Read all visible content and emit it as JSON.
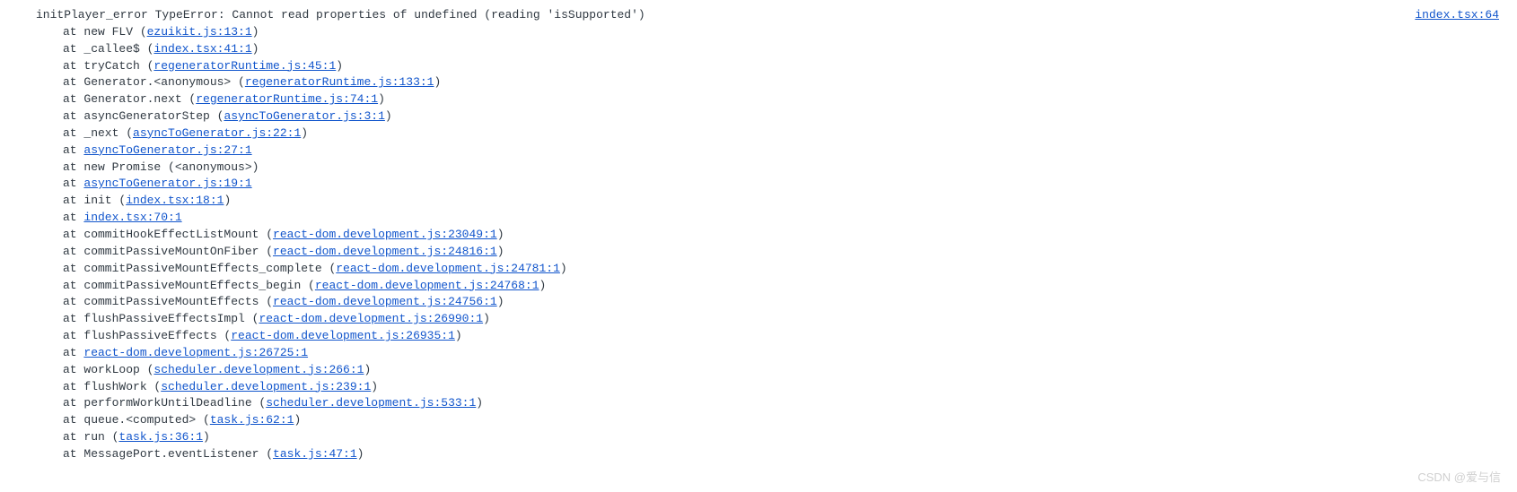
{
  "source_link": "index.tsx:64",
  "error": {
    "prefix": "initPlayer_error TypeError: Cannot read properties of undefined (reading 'isSupported')",
    "stack": [
      {
        "pre": "at new FLV (",
        "link": "ezuikit.js:13:1",
        "post": ")"
      },
      {
        "pre": "at _callee$ (",
        "link": "index.tsx:41:1",
        "post": ")"
      },
      {
        "pre": "at tryCatch (",
        "link": "regeneratorRuntime.js:45:1",
        "post": ")"
      },
      {
        "pre": "at Generator.<anonymous> (",
        "link": "regeneratorRuntime.js:133:1",
        "post": ")"
      },
      {
        "pre": "at Generator.next (",
        "link": "regeneratorRuntime.js:74:1",
        "post": ")"
      },
      {
        "pre": "at asyncGeneratorStep (",
        "link": "asyncToGenerator.js:3:1",
        "post": ")"
      },
      {
        "pre": "at _next (",
        "link": "asyncToGenerator.js:22:1",
        "post": ")"
      },
      {
        "pre": "at ",
        "link": "asyncToGenerator.js:27:1",
        "post": ""
      },
      {
        "pre": "at new Promise (<anonymous>)",
        "link": "",
        "post": ""
      },
      {
        "pre": "at ",
        "link": "asyncToGenerator.js:19:1",
        "post": ""
      },
      {
        "pre": "at init (",
        "link": "index.tsx:18:1",
        "post": ")"
      },
      {
        "pre": "at ",
        "link": "index.tsx:70:1",
        "post": ""
      },
      {
        "pre": "at commitHookEffectListMount (",
        "link": "react-dom.development.js:23049:1",
        "post": ")"
      },
      {
        "pre": "at commitPassiveMountOnFiber (",
        "link": "react-dom.development.js:24816:1",
        "post": ")"
      },
      {
        "pre": "at commitPassiveMountEffects_complete (",
        "link": "react-dom.development.js:24781:1",
        "post": ")"
      },
      {
        "pre": "at commitPassiveMountEffects_begin (",
        "link": "react-dom.development.js:24768:1",
        "post": ")"
      },
      {
        "pre": "at commitPassiveMountEffects (",
        "link": "react-dom.development.js:24756:1",
        "post": ")"
      },
      {
        "pre": "at flushPassiveEffectsImpl (",
        "link": "react-dom.development.js:26990:1",
        "post": ")"
      },
      {
        "pre": "at flushPassiveEffects (",
        "link": "react-dom.development.js:26935:1",
        "post": ")"
      },
      {
        "pre": "at ",
        "link": "react-dom.development.js:26725:1",
        "post": ""
      },
      {
        "pre": "at workLoop (",
        "link": "scheduler.development.js:266:1",
        "post": ")"
      },
      {
        "pre": "at flushWork (",
        "link": "scheduler.development.js:239:1",
        "post": ")"
      },
      {
        "pre": "at performWorkUntilDeadline (",
        "link": "scheduler.development.js:533:1",
        "post": ")"
      },
      {
        "pre": "at queue.<computed> (",
        "link": "task.js:62:1",
        "post": ")"
      },
      {
        "pre": "at run (",
        "link": "task.js:36:1",
        "post": ")"
      },
      {
        "pre": "at MessagePort.eventListener (",
        "link": "task.js:47:1",
        "post": ")"
      }
    ]
  },
  "watermark": "CSDN @爱与信"
}
